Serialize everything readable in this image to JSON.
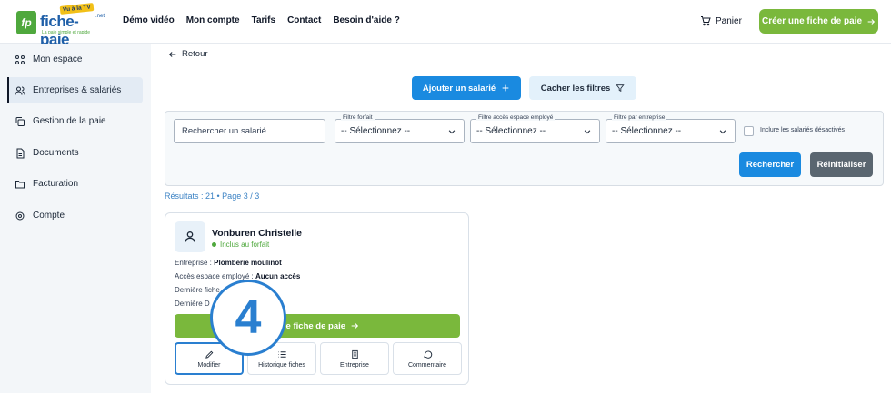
{
  "header": {
    "logo": {
      "abbr": "fp",
      "name": "fiche-paie",
      "suffix": ".net",
      "badge": "Vu à la TV",
      "tagline": "La paie simple et rapide"
    },
    "nav": [
      "Démo vidéo",
      "Mon compte",
      "Tarifs",
      "Contact",
      "Besoin d'aide ?"
    ],
    "cart_label": "Panier",
    "cta_label": "Créer une fiche de paie"
  },
  "sidebar": {
    "items": [
      {
        "label": "Mon espace",
        "icon": "grid-icon"
      },
      {
        "label": "Entreprises & salariés",
        "icon": "users-icon",
        "active": true
      },
      {
        "label": "Gestion de la paie",
        "icon": "copy-icon"
      },
      {
        "label": "Documents",
        "icon": "document-icon"
      },
      {
        "label": "Facturation",
        "icon": "folder-icon"
      },
      {
        "label": "Compte",
        "icon": "gear-icon"
      }
    ]
  },
  "main": {
    "back_label": "Retour",
    "add_employee_label": "Ajouter un salarié",
    "hide_filters_label": "Cacher les filtres",
    "filters": {
      "search_placeholder": "Rechercher un salarié",
      "forfait": {
        "label": "Filtre forfait",
        "value": "-- Sélectionnez --"
      },
      "acces": {
        "label": "Filtre accès espace employé",
        "value": "-- Sélectionnez --"
      },
      "entreprise": {
        "label": "Filtre par entreprise",
        "value": "-- Sélectionnez --"
      },
      "include_disabled_label": "Inclure les salariés désactivés",
      "search_button": "Rechercher",
      "reset_button": "Réinitialiser"
    },
    "results_text": "Résultats : 21  • Page 3 / 3",
    "card": {
      "name": "Vonburen Christelle",
      "status": "Inclus au forfait",
      "company_label": "Entreprise :",
      "company_value": "Plomberie moulinot",
      "access_label": "Accès espace employé :",
      "access_value": "Aucun accès",
      "last_fiche_label": "Dernière fiche",
      "last_d_label": "Dernière D",
      "cta_label": "une fiche de paie",
      "actions": [
        "Modifier",
        "Historique fiches",
        "Entreprise",
        "Commentaire"
      ]
    },
    "step_number": "4"
  },
  "colors": {
    "accent_blue": "#1a8ae0",
    "green": "#7ab83c",
    "step_blue": "#2a7fd0"
  }
}
